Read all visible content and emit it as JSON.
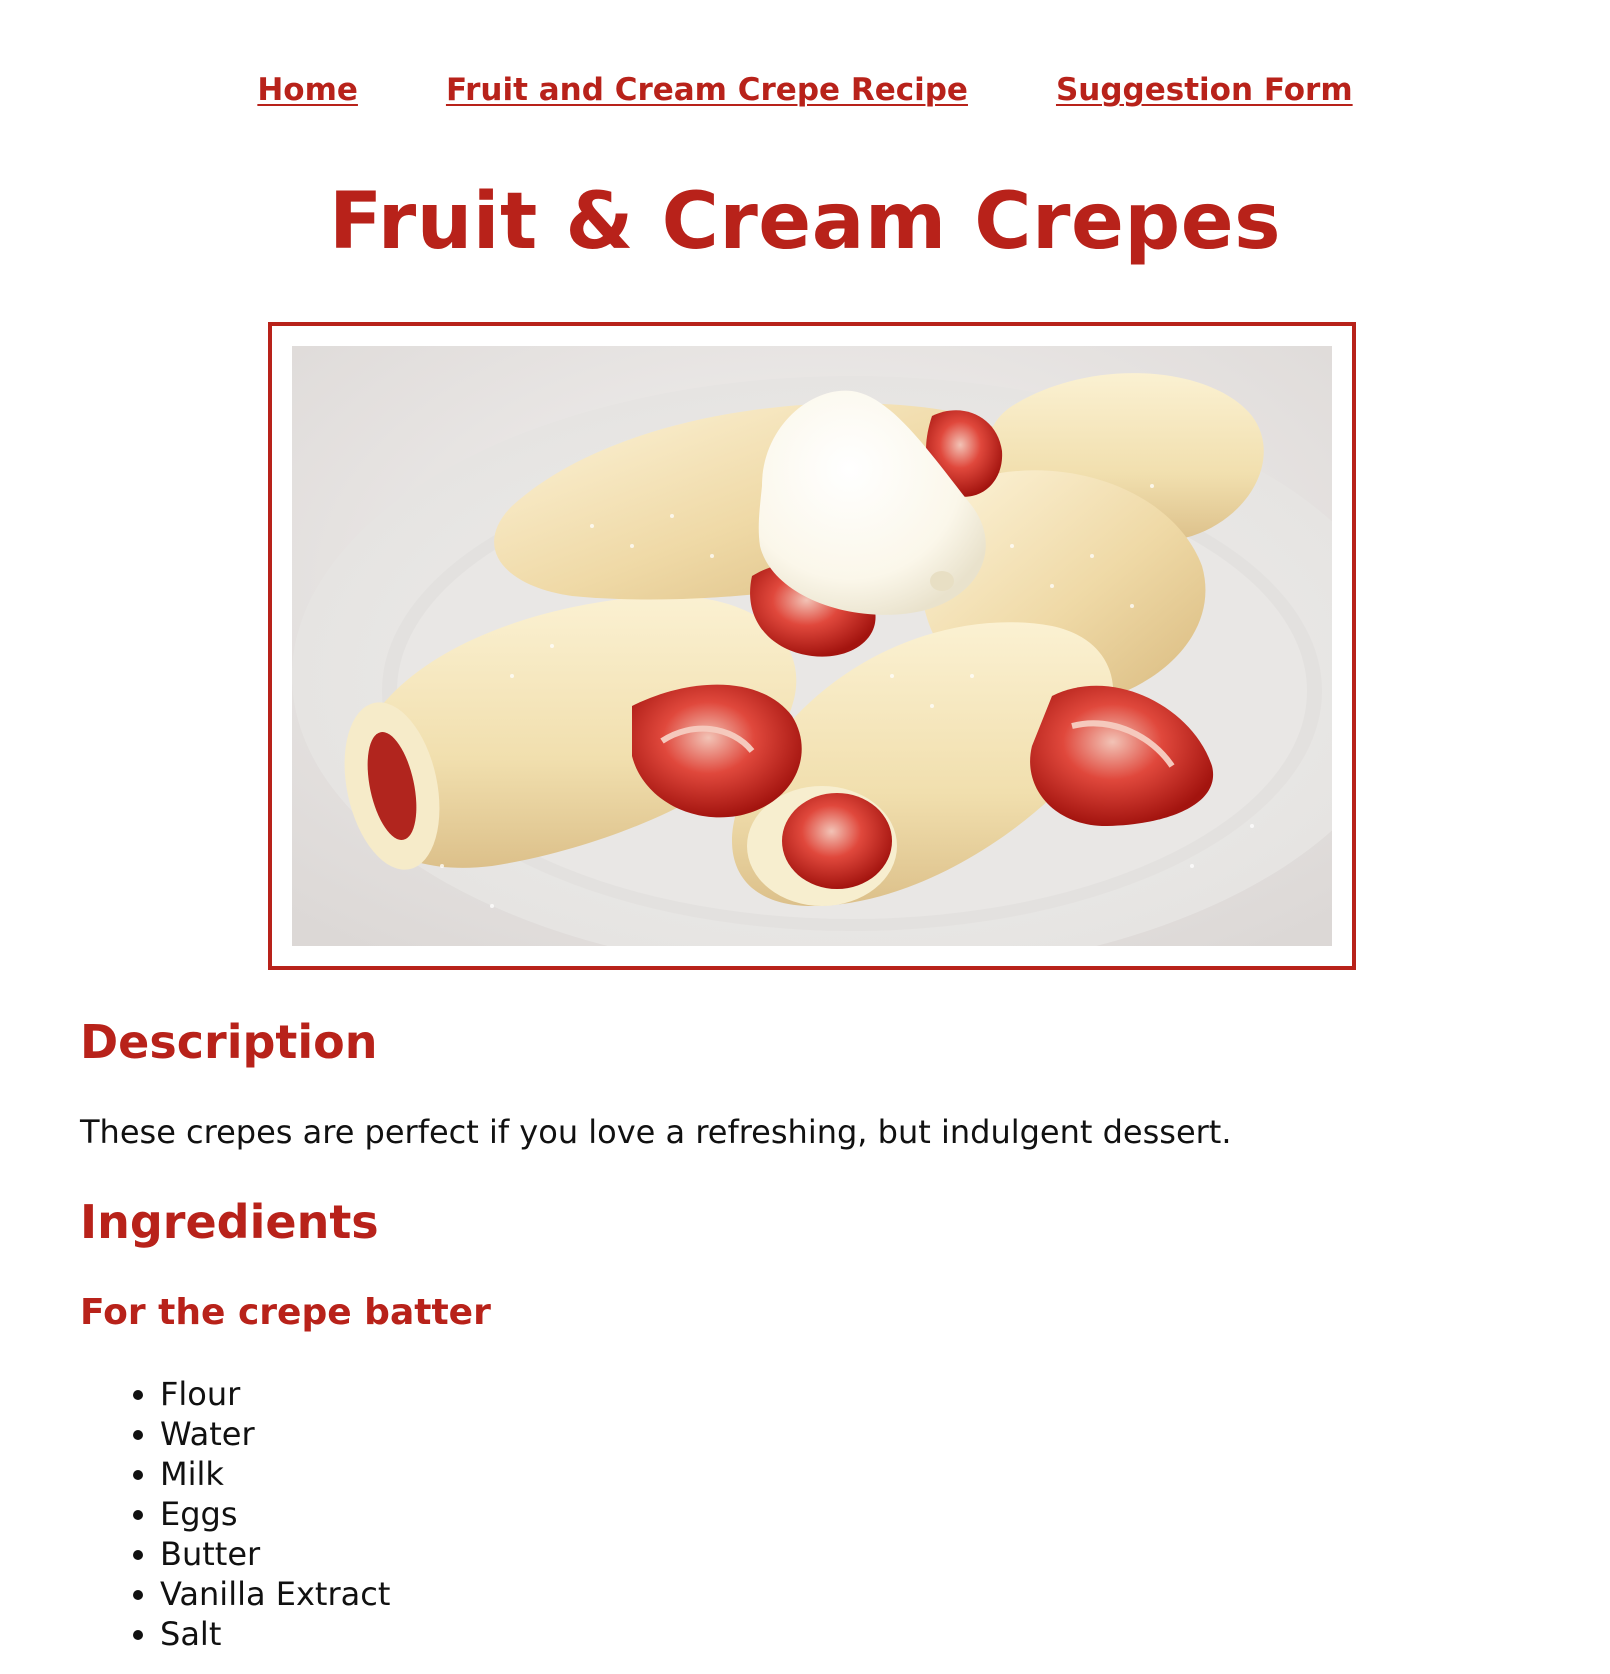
{
  "nav": {
    "items": [
      {
        "label": "Home"
      },
      {
        "label": "Fruit and Cream Crepe Recipe"
      },
      {
        "label": "Suggestion Form"
      }
    ]
  },
  "page": {
    "title": "Fruit & Cream Crepes"
  },
  "description": {
    "heading": "Description",
    "text": "These crepes are perfect if you love a refreshing, but indulgent dessert."
  },
  "ingredients": {
    "heading": "Ingredients",
    "batter": {
      "heading": "For the crepe batter",
      "items": [
        "Flour",
        "Water",
        "Milk",
        "Eggs",
        "Butter",
        "Vanilla Extract",
        "Salt"
      ]
    }
  },
  "colors": {
    "accent": "#b8221a",
    "text": "#111111"
  }
}
